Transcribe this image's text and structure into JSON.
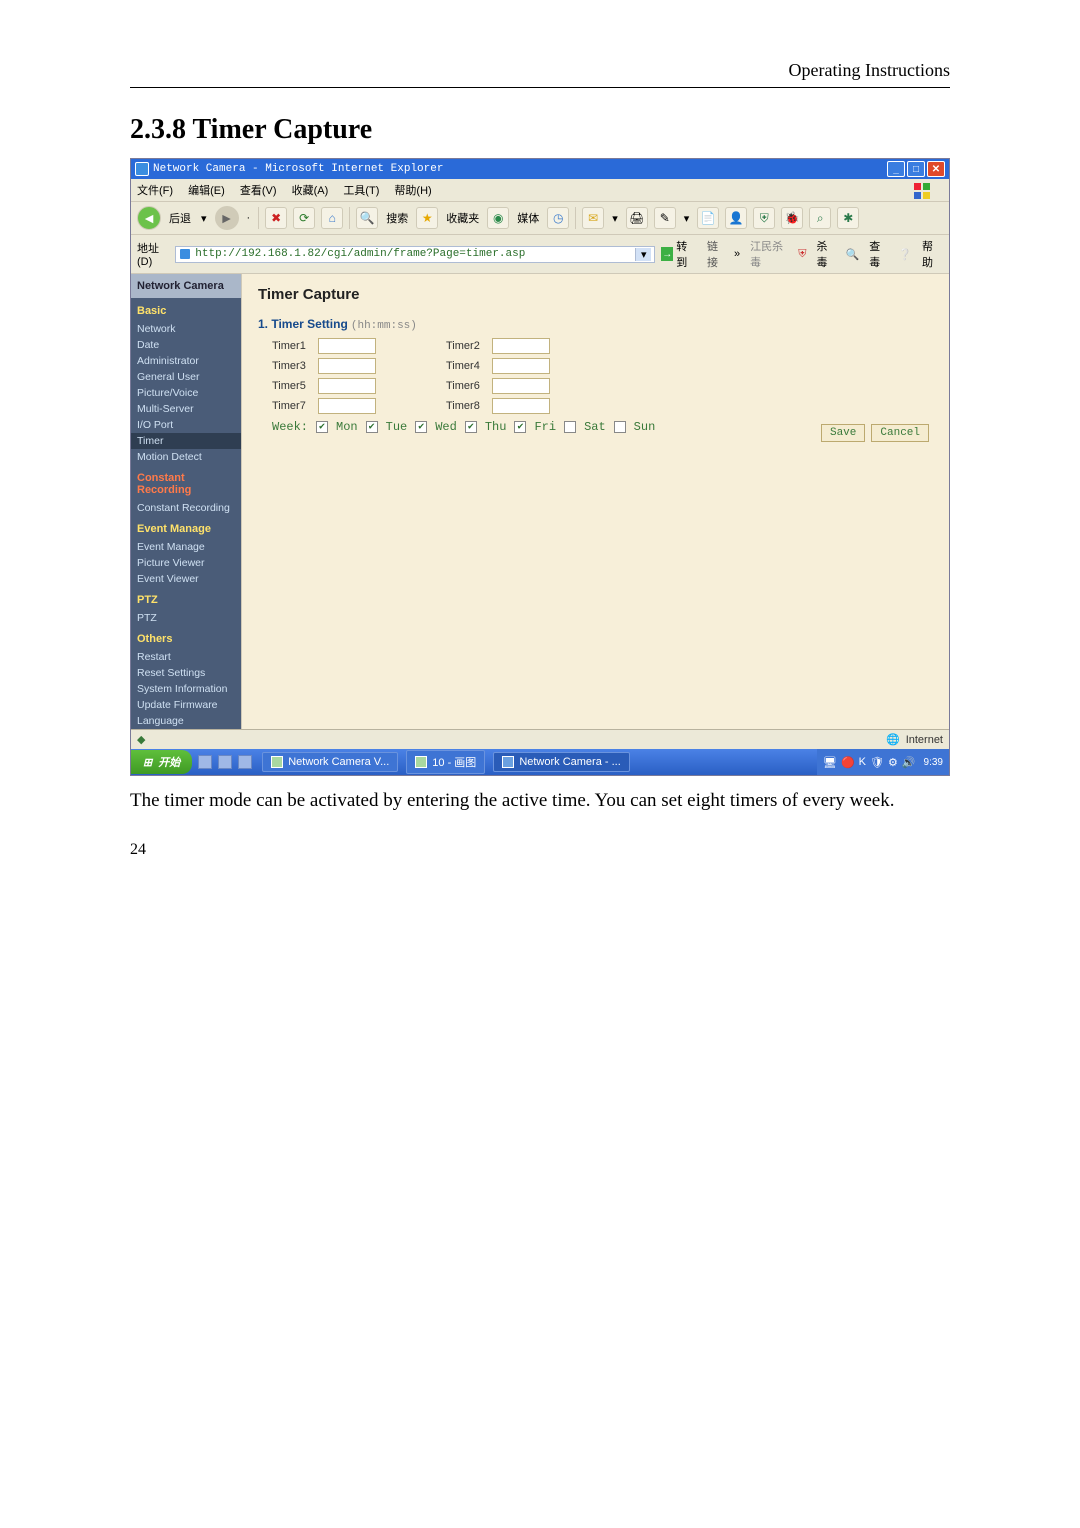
{
  "document": {
    "header": "Operating Instructions",
    "section_title": "2.3.8 Timer Capture",
    "body_text": "The timer mode can be activated by entering the  active time. You can set eight timers of every week.",
    "page_number": "24"
  },
  "window": {
    "title": "Network Camera - Microsoft Internet Explorer",
    "menus": {
      "file": "文件(F)",
      "edit": "编辑(E)",
      "view": "查看(V)",
      "fav": "收藏(A)",
      "tools": "工具(T)",
      "help": "帮助(H)"
    },
    "toolbar": {
      "back": "后退",
      "search": "搜索",
      "favorites": "收藏夹",
      "media": "媒体"
    },
    "address": {
      "label": "地址(D)",
      "url": "http://192.168.1.82/cgi/admin/frame?Page=timer.asp",
      "go": "转到",
      "links": "链接",
      "extra1": "江民杀毒",
      "extra2": "杀毒",
      "extra3": "查毒",
      "extra4": "帮助"
    },
    "status": {
      "zone": "Internet"
    }
  },
  "sidebar": {
    "title": "Network Camera",
    "basic": {
      "head": "Basic",
      "items": [
        "Network",
        "Date",
        "Administrator",
        "General User",
        "Picture/Voice",
        "Multi-Server",
        "I/O Port",
        "Timer",
        "Motion Detect"
      ]
    },
    "constant": {
      "head": "Constant Recording",
      "items": [
        "Constant Recording"
      ]
    },
    "eventmgr": {
      "head": "Event Manage",
      "items": [
        "Event Manage",
        "Picture Viewer",
        "Event Viewer"
      ]
    },
    "ptz": {
      "head": "PTZ",
      "items": [
        "PTZ"
      ]
    },
    "others": {
      "head": "Others",
      "items": [
        "Restart",
        "Reset Settings",
        "System Information",
        "Update Firmware",
        "Language"
      ]
    }
  },
  "content": {
    "title": "Timer Capture",
    "section_label": "1. Timer Setting",
    "section_hint": "(hh:mm:ss)",
    "timers": {
      "t1": "Timer1",
      "t2": "Timer2",
      "t3": "Timer3",
      "t4": "Timer4",
      "t5": "Timer5",
      "t6": "Timer6",
      "t7": "Timer7",
      "t8": "Timer8"
    },
    "week_label": "Week:",
    "days": {
      "mon": "Mon",
      "tue": "Tue",
      "wed": "Wed",
      "thu": "Thu",
      "fri": "Fri",
      "sat": "Sat",
      "sun": "Sun"
    },
    "checked": {
      "mon": true,
      "tue": true,
      "wed": true,
      "thu": true,
      "fri": true,
      "sat": false,
      "sun": false
    },
    "save": "Save",
    "cancel": "Cancel"
  },
  "taskbar": {
    "start": "开始",
    "app1": "Network Camera V...",
    "app2": "10 - 画图",
    "app3": "Network Camera - ...",
    "clock": "9:39"
  }
}
